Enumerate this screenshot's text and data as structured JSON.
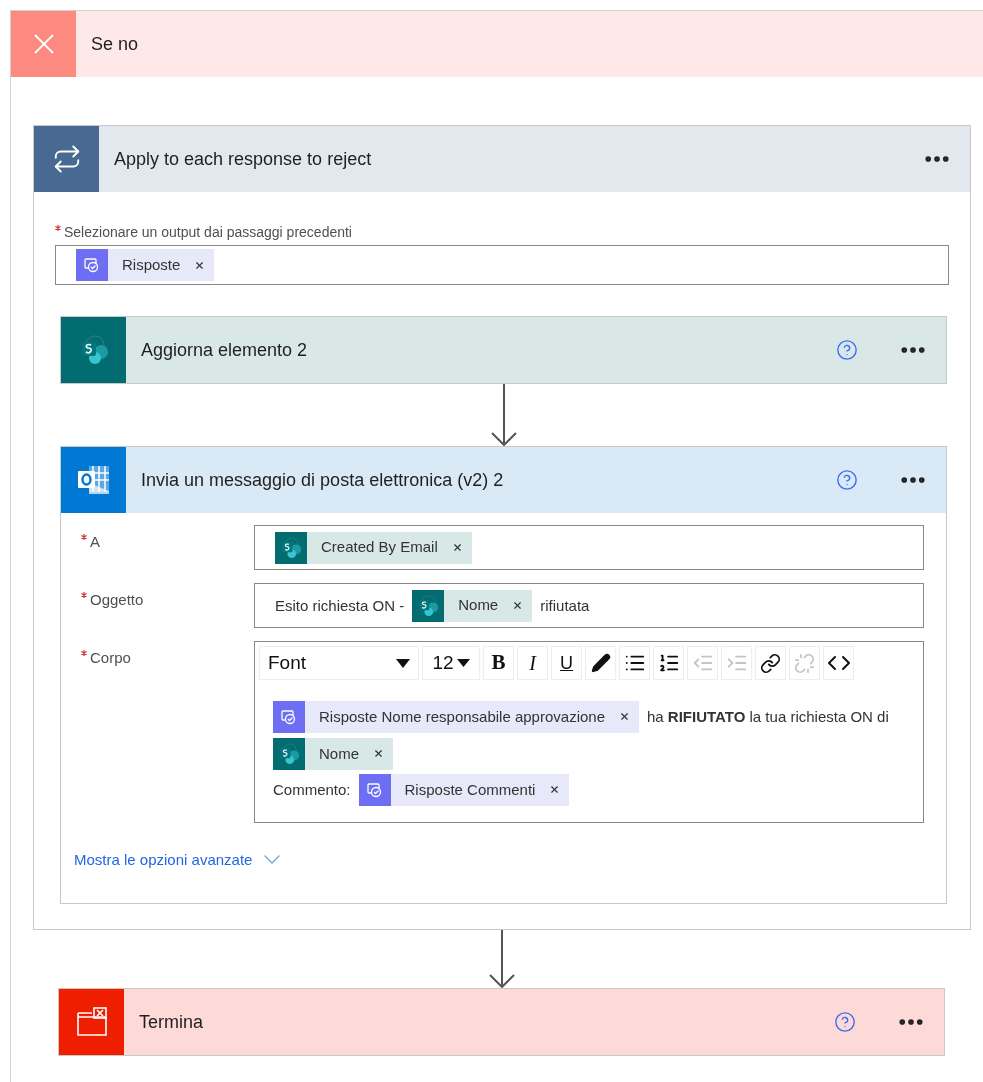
{
  "scope": {
    "kind": "no",
    "title": "Se no"
  },
  "loop": {
    "title": "Apply to each response to reject",
    "field": {
      "label": "Selezionare un output dai passaggi precedenti",
      "required": true,
      "content": [
        {
          "kind": "approval",
          "text": "Risposte"
        }
      ]
    },
    "actions": [
      {
        "kind": "sharepoint",
        "title": "Aggiorna elemento 2"
      },
      {
        "kind": "outlook",
        "title": "Invia un messaggio di posta elettronica (v2) 2",
        "fields": [
          {
            "kind": "text",
            "label": "A",
            "required": true,
            "content": [
              {
                "kind": "sharepoint",
                "text": "Created By Email"
              }
            ]
          },
          {
            "kind": "text",
            "label": "Oggetto",
            "required": true,
            "content": [
              {
                "kind": "text",
                "text": "Esito richiesta ON -"
              },
              {
                "kind": "sharepoint",
                "text": "Nome"
              },
              {
                "kind": "text",
                "text": "rifiutata"
              }
            ]
          },
          {
            "kind": "rich",
            "label": "Corpo",
            "required": true,
            "toolbar": [
              {
                "kind": "font",
                "text": "Font",
                "disabled": false
              },
              {
                "kind": "size",
                "text": "12",
                "disabled": false
              },
              {
                "kind": "bold",
                "text": "B",
                "disabled": false
              },
              {
                "kind": "italic",
                "text": "I",
                "disabled": false
              },
              {
                "kind": "underline",
                "text": "U",
                "disabled": false
              },
              {
                "kind": "color",
                "disabled": false
              },
              {
                "kind": "bullets",
                "disabled": false
              },
              {
                "kind": "numbers",
                "disabled": false
              },
              {
                "kind": "outdent",
                "disabled": true
              },
              {
                "kind": "indent",
                "disabled": true
              },
              {
                "kind": "link",
                "disabled": false
              },
              {
                "kind": "unlink",
                "disabled": true
              },
              {
                "kind": "code",
                "disabled": false
              }
            ],
            "lines": [
              [
                {
                  "kind": "approval",
                  "text": "Risposte Nome responsabile approvazione"
                },
                {
                  "kind": "text",
                  "text": "ha **RIFIUTATO** la tua richiesta ON di"
                },
                {
                  "kind": "sharepoint",
                  "text": "Nome"
                }
              ],
              [
                {
                  "kind": "text",
                  "text": "Commento:"
                },
                {
                  "kind": "approval",
                  "text": "Risposte Commenti"
                }
              ]
            ]
          }
        ],
        "advanced": "Mostra le opzioni avanzate"
      }
    ]
  },
  "after": [
    {
      "kind": "terminate",
      "title": "Termina"
    }
  ]
}
